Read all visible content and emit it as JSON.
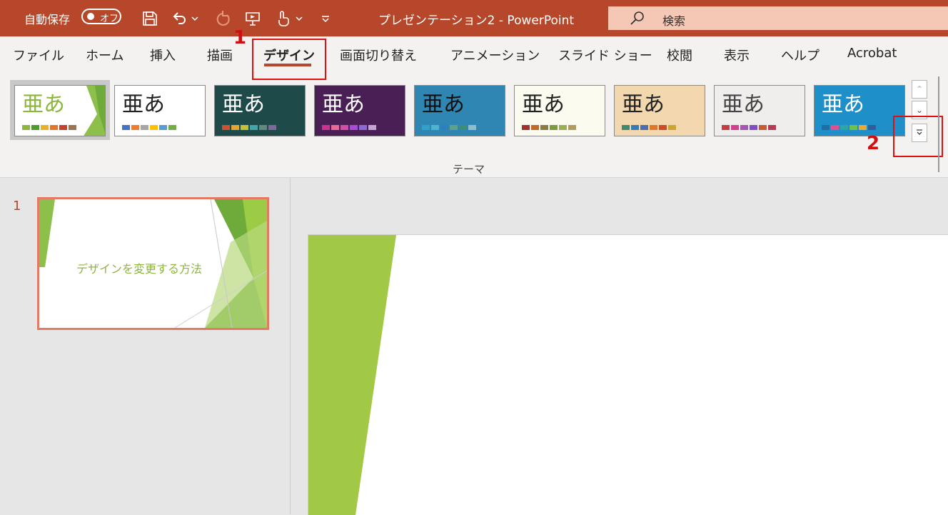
{
  "titlebar": {
    "autosave_label": "自動保存",
    "autosave_state": "オフ",
    "doc_title": "プレゼンテーション2  -  PowerPoint",
    "search_placeholder": "検索",
    "bg_color": "#b7472a"
  },
  "quick_access": [
    "save-icon",
    "undo-icon",
    "undo-dropdown-icon",
    "redo-icon",
    "present-icon",
    "touch-mode-icon",
    "touch-dropdown-icon",
    "customize-icon"
  ],
  "tabs": [
    {
      "label": "ファイル"
    },
    {
      "label": "ホーム"
    },
    {
      "label": "挿入"
    },
    {
      "label": "描画"
    },
    {
      "label": "デザイン",
      "active": true
    },
    {
      "label": "画面切り替え"
    },
    {
      "label": "アニメーション"
    },
    {
      "label": "スライド ショー"
    },
    {
      "label": "校閲"
    },
    {
      "label": "表示"
    },
    {
      "label": "ヘルプ"
    },
    {
      "label": "Acrobat"
    }
  ],
  "callouts": [
    "1",
    "2"
  ],
  "themes_group_label": "テーマ",
  "themes": [
    {
      "sample": "亜あ",
      "bg": "#ffffff",
      "text": "#8cb63c",
      "swatches": [
        "#8cb63c",
        "#4e9a2f",
        "#e8b221",
        "#e0762b",
        "#c9402a",
        "#9c7350"
      ]
    },
    {
      "sample": "亜あ",
      "bg": "#ffffff",
      "text": "#222222",
      "swatches": [
        "#4472c4",
        "#ed7d31",
        "#a5a5a5",
        "#ffc000",
        "#5b9bd5",
        "#70ad47"
      ]
    },
    {
      "sample": "亜あ",
      "bg": "#1e4a4a",
      "text": "#ffffff",
      "swatches": [
        "#d1502f",
        "#e0a631",
        "#c8c033",
        "#43a5a8",
        "#5f8a7c",
        "#7c6a98"
      ]
    },
    {
      "sample": "亜あ",
      "bg": "#4a1f55",
      "text": "#ffffff",
      "swatches": [
        "#d0308f",
        "#e86a9a",
        "#d64da8",
        "#a64cd8",
        "#8b6ad8",
        "#c6a3d4"
      ]
    },
    {
      "sample": "亜あ",
      "bg": "#2f86b3",
      "text": "#111111",
      "swatches": [
        "#2ea3c9",
        "#4bb4cf",
        "#2f7fbf",
        "#5da18d",
        "#3e8d76",
        "#8dbecc"
      ]
    },
    {
      "sample": "亜あ",
      "bg": "#fbfbf0",
      "text": "#222222",
      "swatches": [
        "#a43030",
        "#c36a2a",
        "#8b7b45",
        "#7c9a43",
        "#9aae56",
        "#b29a60"
      ]
    },
    {
      "sample": "亜あ",
      "bg": "#f3d7ae",
      "text": "#222222",
      "swatches": [
        "#3c8a6f",
        "#3a7ab5",
        "#4a6fb0",
        "#e0782b",
        "#d04a2a",
        "#c9a633"
      ]
    },
    {
      "sample": "亜あ",
      "bg": "#f0eded",
      "text": "#444444",
      "swatches": [
        "#c53e3e",
        "#d43f8f",
        "#a953b8",
        "#7f4fc3",
        "#c95b2f",
        "#b73a55"
      ]
    },
    {
      "sample": "亜あ",
      "bg": "#1e8fc8",
      "text": "#ffffff",
      "swatches": [
        "#1d6fa3",
        "#e04f8f",
        "#2aa7a0",
        "#6fbf4a",
        "#f0a72d",
        "#2f5f9a"
      ]
    }
  ],
  "slide": {
    "number": "1",
    "thumb_title": "デザインを変更する方法"
  },
  "colors": {
    "accent": "#b7472a",
    "callout_red": "#e01010",
    "slide_green": "#a2c945"
  }
}
